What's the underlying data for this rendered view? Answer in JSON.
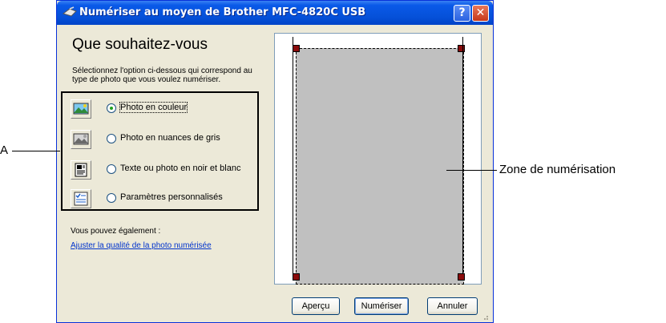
{
  "window": {
    "title": "Numériser au moyen de Brother MFC-4820C USB",
    "help_label": "?",
    "close_label": "✕"
  },
  "panel": {
    "heading": "Que souhaitez-vous",
    "description": "Sélectionnez l'option ci-dessous qui correspond au type de photo que vous voulez numériser."
  },
  "options": [
    {
      "label": "Photo en couleur",
      "selected": true,
      "icon": "color-photo-icon"
    },
    {
      "label": "Photo en nuances de gris",
      "selected": false,
      "icon": "grayscale-photo-icon"
    },
    {
      "label": "Texte ou photo en noir et blanc",
      "selected": false,
      "icon": "black-white-text-icon"
    },
    {
      "label": "Paramètres personnalisés",
      "selected": false,
      "icon": "custom-settings-icon"
    }
  ],
  "extra": {
    "also_label": "Vous pouvez également :",
    "adjust_link": "Ajuster la qualité de la photo numérisée"
  },
  "buttons": {
    "preview": "Aperçu",
    "scan": "Numériser",
    "cancel": "Annuler"
  },
  "annotations": {
    "a_label": "A",
    "zone_label": "Zone de numérisation"
  },
  "colors": {
    "titlebar": "#0550d8",
    "window_bg": "#ece9d8",
    "scan_area": "#c0c0c0",
    "handle": "#8a0b0b",
    "link": "#0033cc"
  }
}
